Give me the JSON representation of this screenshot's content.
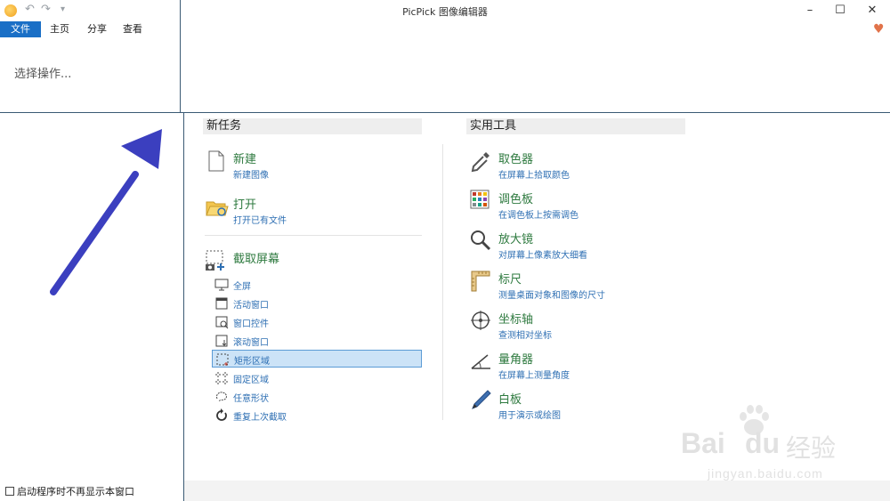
{
  "window": {
    "title": "PicPick 图像编辑器"
  },
  "tabs": [
    {
      "label": "文件"
    },
    {
      "label": "主页"
    },
    {
      "label": "分享"
    },
    {
      "label": "查看"
    }
  ],
  "backstage": {
    "select_operation": "选择操作...",
    "startup_checkbox": "启动程序时不再显示本窗口",
    "startup_checked": false
  },
  "new_tasks": {
    "header": "新任务",
    "new": {
      "title": "新建",
      "subtitle": "新建图像"
    },
    "open": {
      "title": "打开",
      "subtitle": "打开已有文件"
    },
    "capture": {
      "title": "截取屏幕",
      "items": [
        {
          "label": "全屏"
        },
        {
          "label": "活动窗口"
        },
        {
          "label": "窗口控件"
        },
        {
          "label": "滚动窗口"
        },
        {
          "label": "矩形区域",
          "selected": true
        },
        {
          "label": "固定区域"
        },
        {
          "label": "任意形状"
        },
        {
          "label": "重复上次截取"
        }
      ]
    }
  },
  "tools": {
    "header": "实用工具",
    "items": [
      {
        "title": "取色器",
        "subtitle": "在屏幕上拾取颜色"
      },
      {
        "title": "调色板",
        "subtitle": "在调色板上按需调色"
      },
      {
        "title": "放大镜",
        "subtitle": "对屏幕上像素放大细看"
      },
      {
        "title": "标尺",
        "subtitle": "测量桌面对象和图像的尺寸"
      },
      {
        "title": "坐标轴",
        "subtitle": "查测相对坐标"
      },
      {
        "title": "量角器",
        "subtitle": "在屏幕上测量角度"
      },
      {
        "title": "白板",
        "subtitle": "用于演示或绘图"
      }
    ]
  },
  "watermark": {
    "brand": "Bai",
    "brand2": "du",
    "cn": "经验",
    "url": "jingyan.baidu.com"
  },
  "colors": {
    "accent": "#1a6fc6",
    "title_green": "#2e7a3f",
    "link_blue": "#2e6fb3",
    "arrow": "#3b3fbf",
    "heart": "#e1734a"
  }
}
